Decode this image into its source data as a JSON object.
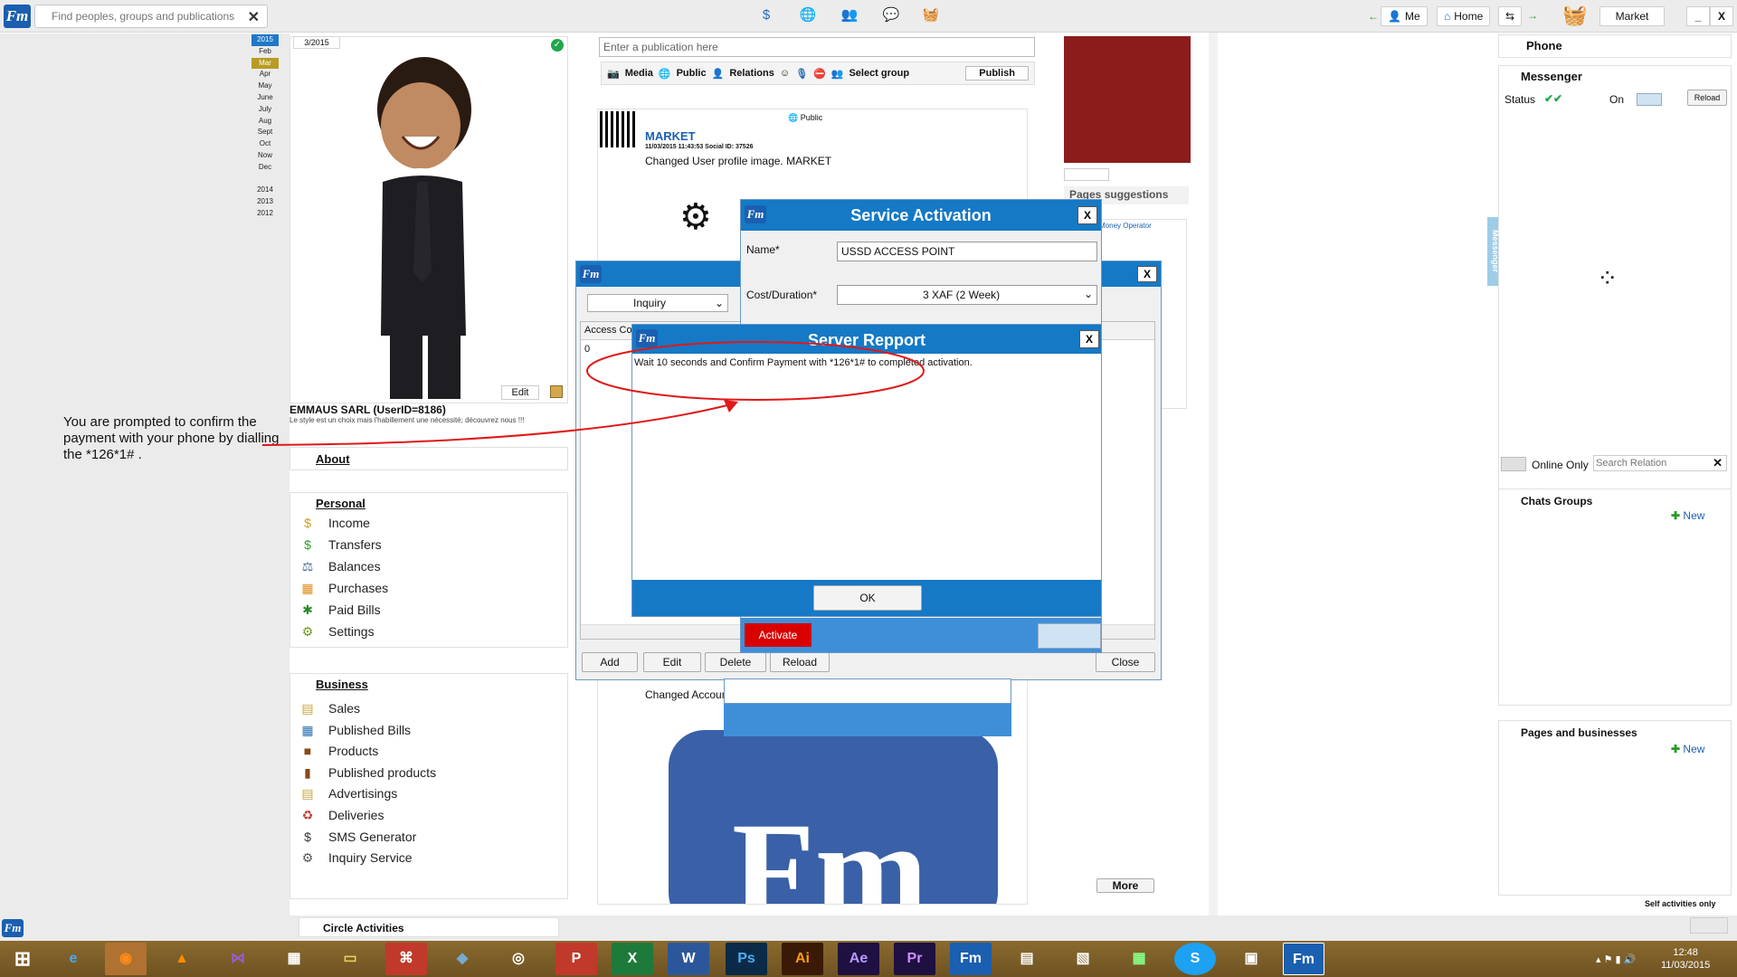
{
  "topbar": {
    "search_placeholder": "Find peoples, groups and publications",
    "me": "Me",
    "home": "Home",
    "market": "Market",
    "minimize": "_",
    "close": "X"
  },
  "calendar": {
    "months": [
      "2015",
      "Feb",
      "Mar",
      "Apr",
      "May",
      "June",
      "July",
      "Aug",
      "Sept",
      "Oct",
      "Now",
      "Dec"
    ],
    "years": [
      "2014",
      "2013",
      "2012"
    ]
  },
  "profile": {
    "date": "3/2015",
    "edit": "Edit",
    "name": "EMMAUS SARL (UserID=8186)",
    "slogan": "Le style est un choix mais l'habillement une nécessité; découvrez nous !!!"
  },
  "annotation": "You are prompted to confirm the payment with your phone by dialling the *126*1# .",
  "about": "About",
  "personal": {
    "label": "Personal",
    "items": [
      "Income",
      "Transfers",
      "Balances",
      "Purchases",
      "Paid Bills",
      "Settings"
    ]
  },
  "business": {
    "label": "Business",
    "items": [
      "Sales",
      "Published Bills",
      "Products",
      "Published products",
      "Advertisings",
      "Deliveries",
      "SMS Generator",
      "Inquiry Service"
    ]
  },
  "circle": "Circle Activities",
  "composer": {
    "placeholder": "Enter a publication here",
    "tools": [
      "Media",
      "Public",
      "Relations",
      "Select group"
    ],
    "publish": "Publish"
  },
  "post": {
    "visibility": "Public",
    "author": "MARKET",
    "meta": "11/03/2015 11:43:53   Social ID: 37526",
    "text": "Changed User profile image. MARKET",
    "text2": "Changed Accoun",
    "more": "More"
  },
  "right_col": {
    "pages_suggestions": "Pages suggestions",
    "operator": "Money Operator"
  },
  "phone": "Phone",
  "messenger": {
    "title": "Messenger",
    "status": "Status",
    "on": "On",
    "reload": "Reload",
    "online_only": "Online Only",
    "search_placeholder": "Search Relation",
    "side_tab": "Messenger"
  },
  "chats": {
    "title": "Chats Groups",
    "new": "New"
  },
  "pages": {
    "title": "Pages and businesses",
    "new": "New"
  },
  "self_only": "Self activities only",
  "inquiry": {
    "select": "Inquiry",
    "col": "Access Co",
    "row0": "0",
    "add": "Add",
    "edit": "Edit",
    "delete": "Delete",
    "reload": "Reload",
    "close": "Close",
    "x": "X"
  },
  "service": {
    "title": "Service Activation",
    "name_label": "Name*",
    "name_value": "USSD ACCESS POINT",
    "cost_label": "Cost/Duration*",
    "cost_value": "3 XAF (2 Week)",
    "activate": "Activate",
    "x": "X"
  },
  "server": {
    "title": "Server Repport",
    "message": "Wait 10 seconds and Confirm Payment with *126*1# to completed activation.",
    "ok": "OK",
    "x": "X"
  },
  "tray": {
    "time": "12:48",
    "date": "11/03/2015"
  },
  "logo_text": "Fm",
  "colors": {
    "accent": "#1579c6",
    "activate": "#d90000",
    "annotation": "#e01818"
  }
}
